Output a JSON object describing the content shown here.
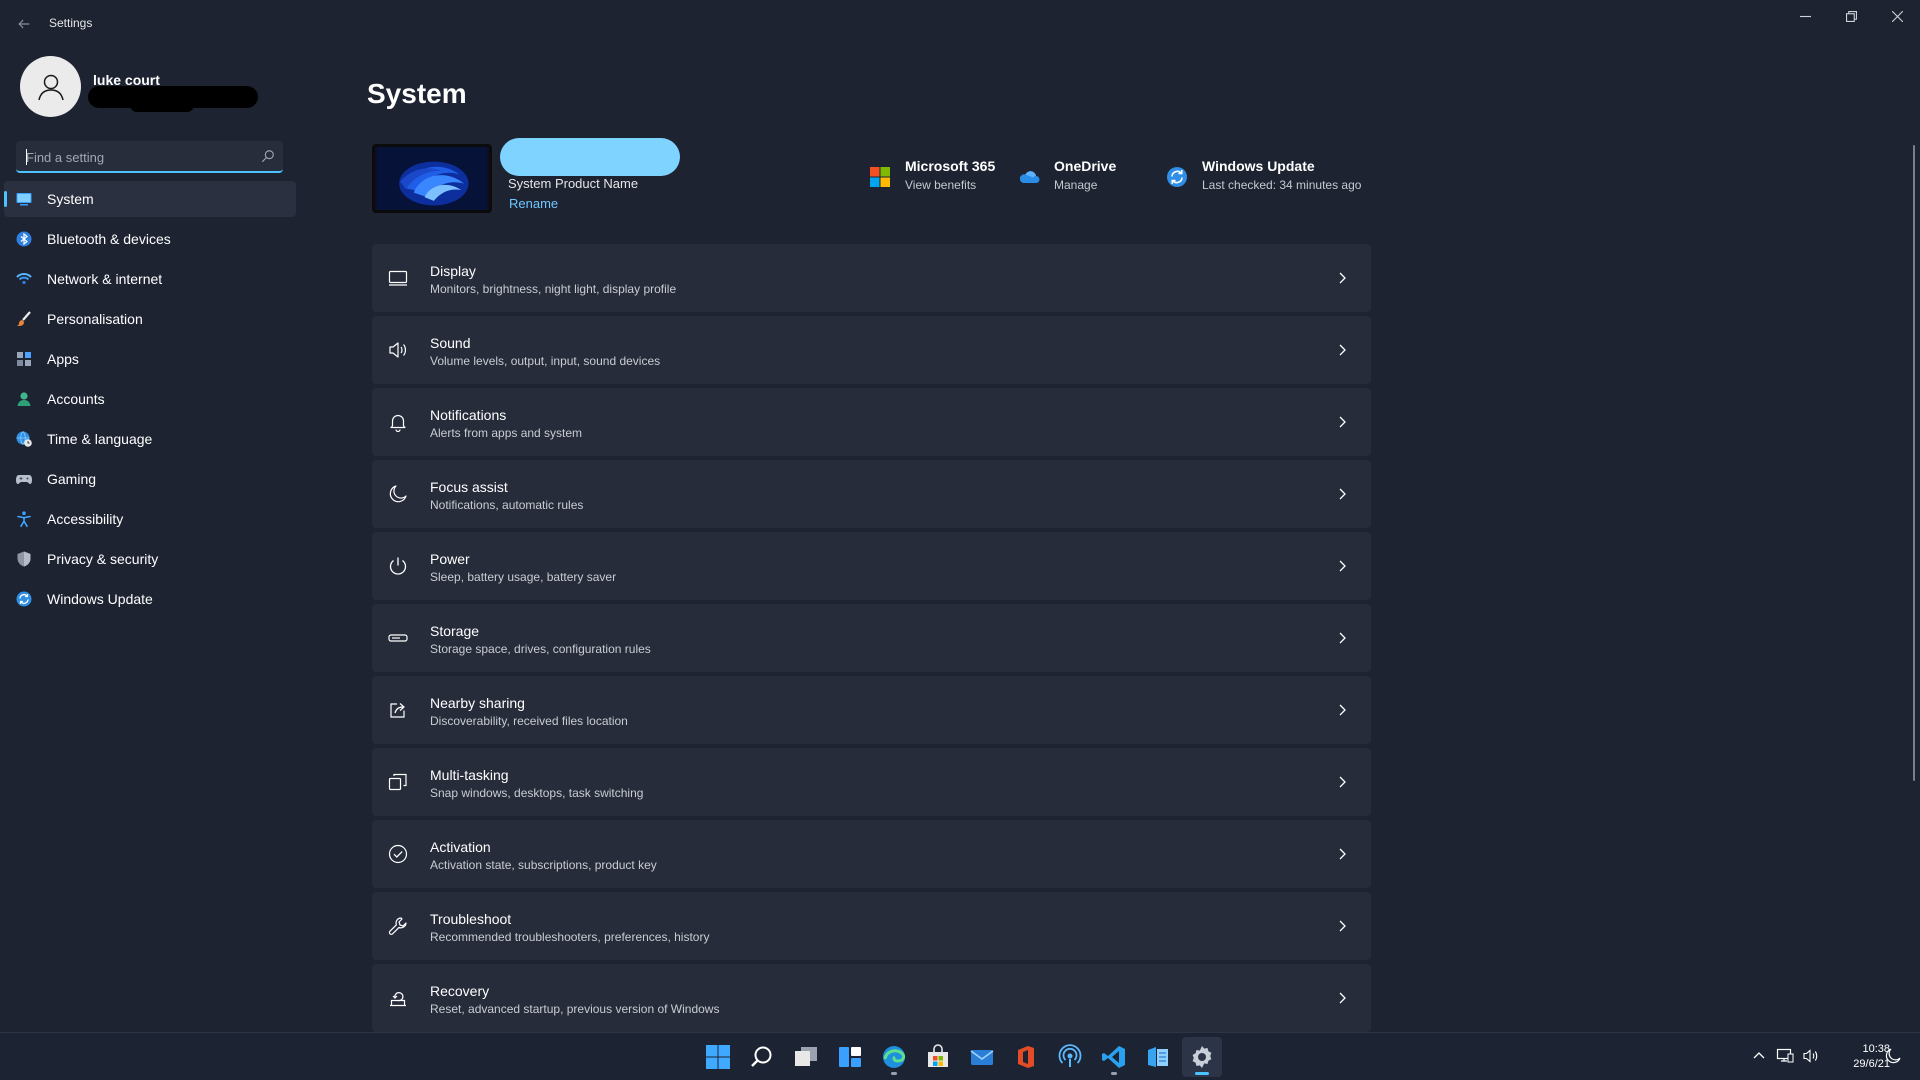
{
  "window": {
    "title": "Settings"
  },
  "profile": {
    "name": "luke court"
  },
  "search": {
    "placeholder": "Find a setting"
  },
  "sidebar": {
    "items": [
      {
        "label": "System",
        "icon": "monitor-icon",
        "active": true
      },
      {
        "label": "Bluetooth & devices",
        "icon": "bluetooth-icon"
      },
      {
        "label": "Network & internet",
        "icon": "wifi-icon"
      },
      {
        "label": "Personalisation",
        "icon": "brush-icon"
      },
      {
        "label": "Apps",
        "icon": "apps-icon"
      },
      {
        "label": "Accounts",
        "icon": "person-icon"
      },
      {
        "label": "Time & language",
        "icon": "globe-clock-icon"
      },
      {
        "label": "Gaming",
        "icon": "gamepad-icon"
      },
      {
        "label": "Accessibility",
        "icon": "accessibility-icon"
      },
      {
        "label": "Privacy & security",
        "icon": "shield-icon"
      },
      {
        "label": "Windows Update",
        "icon": "update-icon"
      }
    ]
  },
  "main": {
    "title": "System",
    "device": {
      "name": "System Product Name",
      "rename_label": "Rename"
    },
    "quick_links": [
      {
        "title": "Microsoft 365",
        "subtitle": "View benefits",
        "icon": "microsoft-logo-icon"
      },
      {
        "title": "OneDrive",
        "subtitle": "Manage",
        "icon": "onedrive-icon"
      },
      {
        "title": "Windows Update",
        "subtitle": "Last checked: 34 minutes ago",
        "icon": "update-icon"
      }
    ],
    "settings": [
      {
        "title": "Display",
        "subtitle": "Monitors, brightness, night light, display profile",
        "icon": "display-icon"
      },
      {
        "title": "Sound",
        "subtitle": "Volume levels, output, input, sound devices",
        "icon": "speaker-icon"
      },
      {
        "title": "Notifications",
        "subtitle": "Alerts from apps and system",
        "icon": "bell-icon"
      },
      {
        "title": "Focus assist",
        "subtitle": "Notifications, automatic rules",
        "icon": "moon-icon"
      },
      {
        "title": "Power",
        "subtitle": "Sleep, battery usage, battery saver",
        "icon": "power-icon"
      },
      {
        "title": "Storage",
        "subtitle": "Storage space, drives, configuration rules",
        "icon": "storage-icon"
      },
      {
        "title": "Nearby sharing",
        "subtitle": "Discoverability, received files location",
        "icon": "share-icon"
      },
      {
        "title": "Multi-tasking",
        "subtitle": "Snap windows, desktops, task switching",
        "icon": "multitask-icon"
      },
      {
        "title": "Activation",
        "subtitle": "Activation state, subscriptions, product key",
        "icon": "check-circle-icon"
      },
      {
        "title": "Troubleshoot",
        "subtitle": "Recommended troubleshooters, preferences, history",
        "icon": "wrench-icon"
      },
      {
        "title": "Recovery",
        "subtitle": "Reset, advanced startup, previous version of Windows",
        "icon": "recovery-icon"
      }
    ]
  },
  "taskbar": {
    "apps": [
      "start-icon",
      "search-icon",
      "task-view-icon",
      "widgets-icon",
      "edge-icon",
      "store-icon",
      "mail-icon",
      "office-icon",
      "podcast-icon",
      "vscode-icon",
      "files-icon",
      "settings-icon"
    ],
    "clock": {
      "time": "10:38",
      "date": "29/6/21"
    }
  },
  "colors": {
    "background": "#1d2331",
    "card": "#272c3a",
    "accent": "#4cc2ff",
    "link": "#70c7ff",
    "taskbar": "#1c2434"
  }
}
